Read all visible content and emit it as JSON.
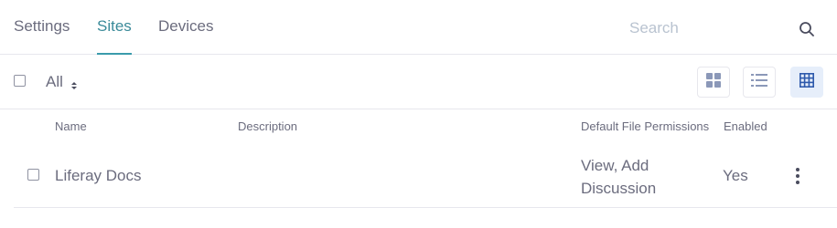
{
  "nav": {
    "tabs": [
      {
        "label": "Settings",
        "active": false
      },
      {
        "label": "Sites",
        "active": true
      },
      {
        "label": "Devices",
        "active": false
      }
    ],
    "search": {
      "placeholder": "Search",
      "value": ""
    },
    "accent_color": "#3a9bac"
  },
  "toolbar": {
    "filter_label": "All",
    "view_modes": [
      {
        "name": "cards",
        "icon": "grid-icon",
        "active": false
      },
      {
        "name": "list",
        "icon": "list-icon",
        "active": false
      },
      {
        "name": "table",
        "icon": "table-icon",
        "active": true
      }
    ]
  },
  "table": {
    "columns": [
      "Name",
      "Description",
      "Default File Permissions",
      "Enabled"
    ],
    "rows": [
      {
        "name": "Liferay Docs",
        "description": "",
        "permissions": "View, Add Discussion",
        "enabled": "Yes"
      }
    ]
  }
}
